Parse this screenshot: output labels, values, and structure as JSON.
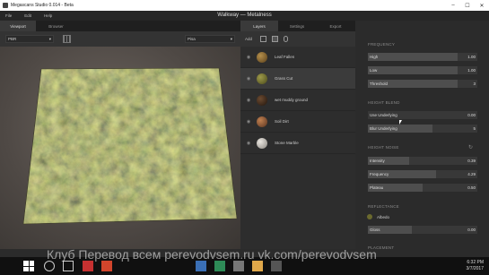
{
  "window": {
    "title": "Megascans Studio 0.014 - Beta",
    "doc_title": "Walkway — Metalness",
    "minimize": "–",
    "maximize": "☐",
    "close": "✕"
  },
  "menu": {
    "items": [
      "File",
      "Edit",
      "Help"
    ]
  },
  "viewport": {
    "tabs": [
      "Viewport",
      "Browser"
    ],
    "render_mode": "PBR",
    "env_value": "Pisa"
  },
  "layers_panel": {
    "tabs": [
      "Layers",
      "Settings",
      "Export"
    ],
    "add_label": "Add",
    "items": [
      {
        "name": "Leaf Fallen",
        "color": "#7a5a2a"
      },
      {
        "name": "Grass Cut",
        "color": "#6b6a2e",
        "selected": true
      },
      {
        "name": "wet muddy ground",
        "color": "#3b2a1c"
      },
      {
        "name": "Soil Dirt",
        "color": "#8a5a35"
      },
      {
        "name": "Stone Marble",
        "color": "#b9b4ae"
      }
    ]
  },
  "properties": {
    "frequency": {
      "title": "FREQUENCY",
      "rows": [
        {
          "label": "High",
          "value": "1.00",
          "fill": 1.0
        },
        {
          "label": "Low",
          "value": "1.00",
          "fill": 1.0
        },
        {
          "label": "Threshold",
          "value": "3",
          "fill": 0.85
        }
      ]
    },
    "height_blend": {
      "title": "HEIGHT BLEND",
      "rows": [
        {
          "label": "Use Underlying",
          "value": "0.00",
          "fill": 0.0
        },
        {
          "label": "Blur Underlying",
          "value": "5",
          "fill": 0.6
        }
      ]
    },
    "height_noise": {
      "title": "HEIGHT NOISE",
      "rows": [
        {
          "label": "Intensity",
          "value": "0.39",
          "fill": 0.38
        },
        {
          "label": "Frequency",
          "value": "4.29",
          "fill": 0.62
        },
        {
          "label": "Plateau",
          "value": "0.50",
          "fill": 0.5
        }
      ]
    },
    "reflectance": {
      "title": "REFLECTANCE",
      "albedo_label": "Albedo",
      "gloss": {
        "label": "Gloss",
        "value": "0.00",
        "fill": 0.4
      }
    },
    "placement_title": "PLACEMENT"
  },
  "watermark": "Клуб Перевод всем    perevodvsem.ru   vk.com/perevodvsem",
  "tray": {
    "time": "6:32 PM",
    "date": "3/7/2017"
  }
}
